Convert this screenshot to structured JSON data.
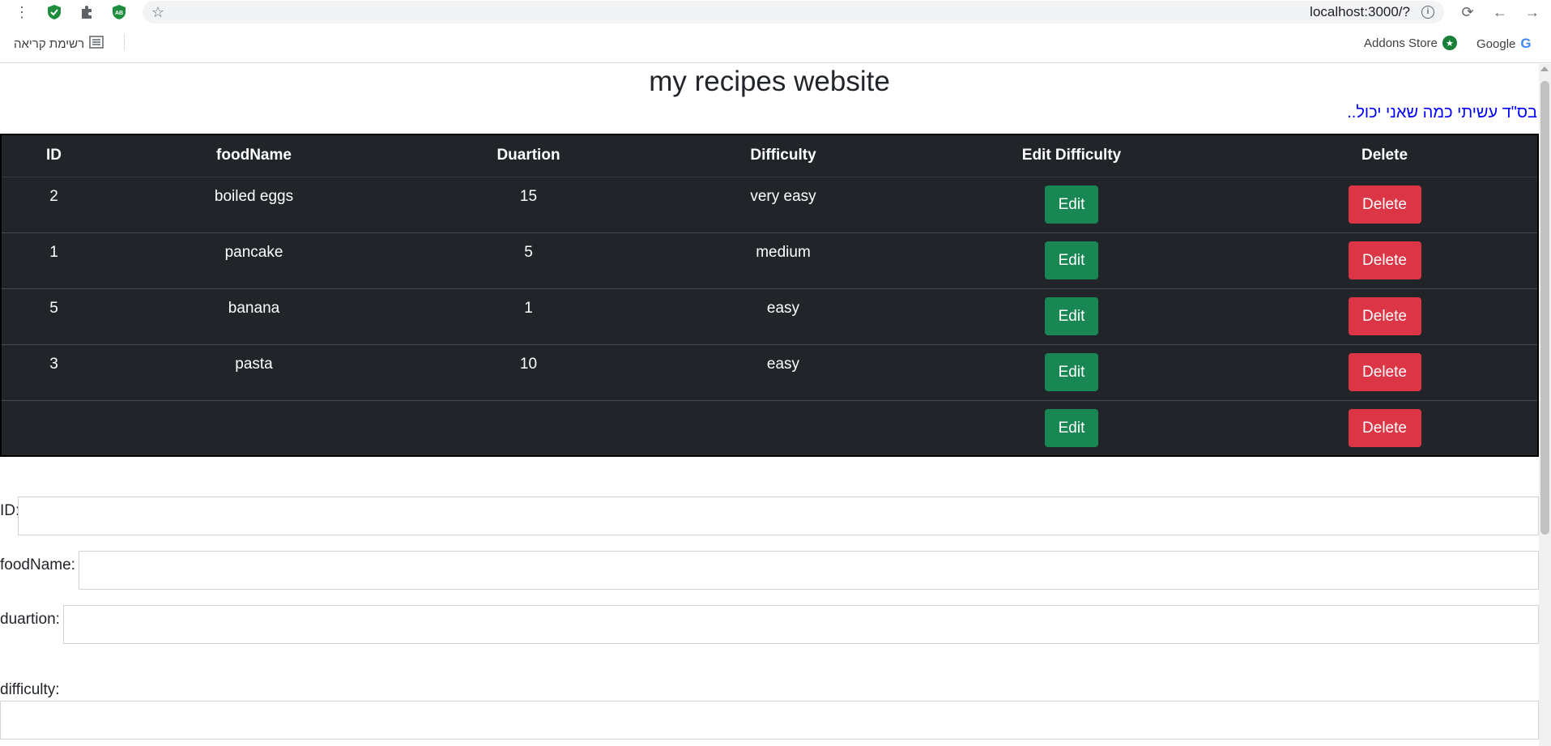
{
  "browser": {
    "url": "localhost:3000/?",
    "bookmarks": {
      "reading_list": "רשימת קריאה",
      "addons_store": "Addons Store",
      "google": "Google"
    }
  },
  "page": {
    "title": "my recipes website",
    "subline": "בס\"ד עשיתי כמה שאני יכול.."
  },
  "table": {
    "headers": [
      "ID",
      "foodName",
      "Duartion",
      "Difficulty",
      "Edit Difficulty",
      "Delete"
    ],
    "rows": [
      {
        "id": "2",
        "foodName": "boiled eggs",
        "duration": "15",
        "difficulty": "very easy"
      },
      {
        "id": "1",
        "foodName": "pancake",
        "duration": "5",
        "difficulty": "medium"
      },
      {
        "id": "5",
        "foodName": "banana",
        "duration": "1",
        "difficulty": "easy"
      },
      {
        "id": "3",
        "foodName": "pasta",
        "duration": "10",
        "difficulty": "easy"
      },
      {
        "id": "",
        "foodName": "",
        "duration": "",
        "difficulty": ""
      }
    ],
    "edit_label": "Edit",
    "delete_label": "Delete"
  },
  "form": {
    "id_label": "ID:",
    "foodName_label": "foodName:",
    "duration_label": "duartion:",
    "difficulty_label": "difficulty:"
  },
  "colors": {
    "table_bg": "#212529",
    "edit_button": "#198754",
    "delete_button": "#dc3545",
    "subline": "#0000ff"
  }
}
